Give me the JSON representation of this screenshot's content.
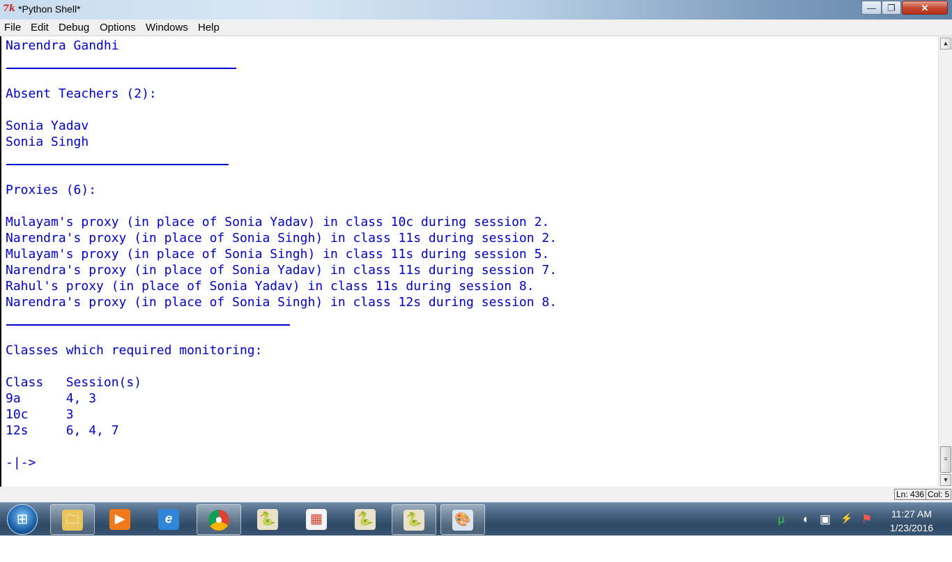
{
  "window": {
    "title": "*Python Shell*",
    "controls": {
      "minimize": "—",
      "maximize": "❐",
      "close": "✕"
    }
  },
  "menu": [
    "File",
    "Edit",
    "Debug",
    "Options",
    "Windows",
    "Help"
  ],
  "shell": {
    "l01": "Narendra Gandhi",
    "l02": "Absent Teachers (2):",
    "l03": "Sonia Yadav",
    "l04": "Sonia Singh",
    "l05": "Proxies (6):",
    "l06": "Mulayam's proxy (in place of Sonia Yadav) in class 10c during session 2.",
    "l07": "Narendra's proxy (in place of Sonia Singh) in class 11s during session 2.",
    "l08": "Mulayam's proxy (in place of Sonia Singh) in class 11s during session 5.",
    "l09": "Narendra's proxy (in place of Sonia Yadav) in class 11s during session 7.",
    "l10": "Rahul's proxy (in place of Sonia Yadav) in class 11s during session 8.",
    "l11": "Narendra's proxy (in place of Sonia Singh) in class 12s during session 8.",
    "l12": "Classes which required monitoring:",
    "l13": "Class   Session(s)",
    "l14": "9a      4, 3",
    "l15": "10c     3",
    "l16": "12s     6, 4, 7",
    "prompt": "-|->"
  },
  "status": {
    "line": "Ln: 436",
    "col": "Col: 5"
  },
  "taskbar": {
    "start_icon": "windows-logo-icon",
    "apps": [
      {
        "name": "explorer",
        "glyph": "🗀",
        "color": "#e8c45a"
      },
      {
        "name": "media-player",
        "glyph": "▶",
        "color": "#f07a1a"
      },
      {
        "name": "internet-explorer",
        "glyph": "e",
        "color": "#2f86d6"
      },
      {
        "name": "chrome",
        "glyph": "◉",
        "color": "#3a9d4a"
      },
      {
        "name": "python-file",
        "glyph": "🐍",
        "color": "#e9e2c8"
      },
      {
        "name": "app-grid",
        "glyph": "▦",
        "color": "#f4f4f4"
      },
      {
        "name": "python-file",
        "glyph": "🐍",
        "color": "#e9e2c8"
      },
      {
        "name": "python-shell",
        "glyph": "🐍",
        "color": "#e9e2c8"
      },
      {
        "name": "paint",
        "glyph": "🎨",
        "color": "#d9e6f2"
      }
    ],
    "time": "11:27 AM",
    "date": "1/23/2016"
  }
}
